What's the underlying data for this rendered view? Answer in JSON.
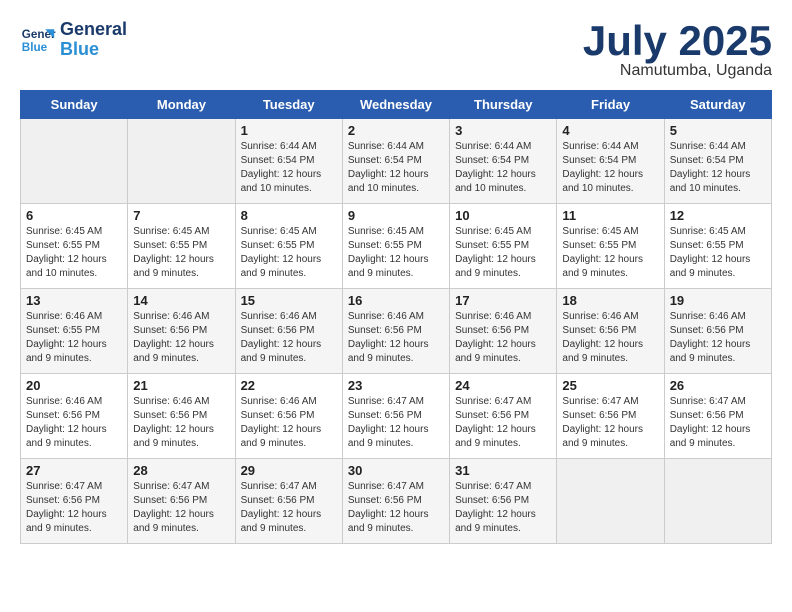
{
  "logo": {
    "line1": "General",
    "line2": "Blue"
  },
  "title": "July 2025",
  "subtitle": "Namutumba, Uganda",
  "days_of_week": [
    "Sunday",
    "Monday",
    "Tuesday",
    "Wednesday",
    "Thursday",
    "Friday",
    "Saturday"
  ],
  "weeks": [
    [
      {
        "day": "",
        "sunrise": "",
        "sunset": "",
        "daylight": ""
      },
      {
        "day": "",
        "sunrise": "",
        "sunset": "",
        "daylight": ""
      },
      {
        "day": "1",
        "sunrise": "Sunrise: 6:44 AM",
        "sunset": "Sunset: 6:54 PM",
        "daylight": "Daylight: 12 hours and 10 minutes."
      },
      {
        "day": "2",
        "sunrise": "Sunrise: 6:44 AM",
        "sunset": "Sunset: 6:54 PM",
        "daylight": "Daylight: 12 hours and 10 minutes."
      },
      {
        "day": "3",
        "sunrise": "Sunrise: 6:44 AM",
        "sunset": "Sunset: 6:54 PM",
        "daylight": "Daylight: 12 hours and 10 minutes."
      },
      {
        "day": "4",
        "sunrise": "Sunrise: 6:44 AM",
        "sunset": "Sunset: 6:54 PM",
        "daylight": "Daylight: 12 hours and 10 minutes."
      },
      {
        "day": "5",
        "sunrise": "Sunrise: 6:44 AM",
        "sunset": "Sunset: 6:54 PM",
        "daylight": "Daylight: 12 hours and 10 minutes."
      }
    ],
    [
      {
        "day": "6",
        "sunrise": "Sunrise: 6:45 AM",
        "sunset": "Sunset: 6:55 PM",
        "daylight": "Daylight: 12 hours and 10 minutes."
      },
      {
        "day": "7",
        "sunrise": "Sunrise: 6:45 AM",
        "sunset": "Sunset: 6:55 PM",
        "daylight": "Daylight: 12 hours and 9 minutes."
      },
      {
        "day": "8",
        "sunrise": "Sunrise: 6:45 AM",
        "sunset": "Sunset: 6:55 PM",
        "daylight": "Daylight: 12 hours and 9 minutes."
      },
      {
        "day": "9",
        "sunrise": "Sunrise: 6:45 AM",
        "sunset": "Sunset: 6:55 PM",
        "daylight": "Daylight: 12 hours and 9 minutes."
      },
      {
        "day": "10",
        "sunrise": "Sunrise: 6:45 AM",
        "sunset": "Sunset: 6:55 PM",
        "daylight": "Daylight: 12 hours and 9 minutes."
      },
      {
        "day": "11",
        "sunrise": "Sunrise: 6:45 AM",
        "sunset": "Sunset: 6:55 PM",
        "daylight": "Daylight: 12 hours and 9 minutes."
      },
      {
        "day": "12",
        "sunrise": "Sunrise: 6:45 AM",
        "sunset": "Sunset: 6:55 PM",
        "daylight": "Daylight: 12 hours and 9 minutes."
      }
    ],
    [
      {
        "day": "13",
        "sunrise": "Sunrise: 6:46 AM",
        "sunset": "Sunset: 6:55 PM",
        "daylight": "Daylight: 12 hours and 9 minutes."
      },
      {
        "day": "14",
        "sunrise": "Sunrise: 6:46 AM",
        "sunset": "Sunset: 6:56 PM",
        "daylight": "Daylight: 12 hours and 9 minutes."
      },
      {
        "day": "15",
        "sunrise": "Sunrise: 6:46 AM",
        "sunset": "Sunset: 6:56 PM",
        "daylight": "Daylight: 12 hours and 9 minutes."
      },
      {
        "day": "16",
        "sunrise": "Sunrise: 6:46 AM",
        "sunset": "Sunset: 6:56 PM",
        "daylight": "Daylight: 12 hours and 9 minutes."
      },
      {
        "day": "17",
        "sunrise": "Sunrise: 6:46 AM",
        "sunset": "Sunset: 6:56 PM",
        "daylight": "Daylight: 12 hours and 9 minutes."
      },
      {
        "day": "18",
        "sunrise": "Sunrise: 6:46 AM",
        "sunset": "Sunset: 6:56 PM",
        "daylight": "Daylight: 12 hours and 9 minutes."
      },
      {
        "day": "19",
        "sunrise": "Sunrise: 6:46 AM",
        "sunset": "Sunset: 6:56 PM",
        "daylight": "Daylight: 12 hours and 9 minutes."
      }
    ],
    [
      {
        "day": "20",
        "sunrise": "Sunrise: 6:46 AM",
        "sunset": "Sunset: 6:56 PM",
        "daylight": "Daylight: 12 hours and 9 minutes."
      },
      {
        "day": "21",
        "sunrise": "Sunrise: 6:46 AM",
        "sunset": "Sunset: 6:56 PM",
        "daylight": "Daylight: 12 hours and 9 minutes."
      },
      {
        "day": "22",
        "sunrise": "Sunrise: 6:46 AM",
        "sunset": "Sunset: 6:56 PM",
        "daylight": "Daylight: 12 hours and 9 minutes."
      },
      {
        "day": "23",
        "sunrise": "Sunrise: 6:47 AM",
        "sunset": "Sunset: 6:56 PM",
        "daylight": "Daylight: 12 hours and 9 minutes."
      },
      {
        "day": "24",
        "sunrise": "Sunrise: 6:47 AM",
        "sunset": "Sunset: 6:56 PM",
        "daylight": "Daylight: 12 hours and 9 minutes."
      },
      {
        "day": "25",
        "sunrise": "Sunrise: 6:47 AM",
        "sunset": "Sunset: 6:56 PM",
        "daylight": "Daylight: 12 hours and 9 minutes."
      },
      {
        "day": "26",
        "sunrise": "Sunrise: 6:47 AM",
        "sunset": "Sunset: 6:56 PM",
        "daylight": "Daylight: 12 hours and 9 minutes."
      }
    ],
    [
      {
        "day": "27",
        "sunrise": "Sunrise: 6:47 AM",
        "sunset": "Sunset: 6:56 PM",
        "daylight": "Daylight: 12 hours and 9 minutes."
      },
      {
        "day": "28",
        "sunrise": "Sunrise: 6:47 AM",
        "sunset": "Sunset: 6:56 PM",
        "daylight": "Daylight: 12 hours and 9 minutes."
      },
      {
        "day": "29",
        "sunrise": "Sunrise: 6:47 AM",
        "sunset": "Sunset: 6:56 PM",
        "daylight": "Daylight: 12 hours and 9 minutes."
      },
      {
        "day": "30",
        "sunrise": "Sunrise: 6:47 AM",
        "sunset": "Sunset: 6:56 PM",
        "daylight": "Daylight: 12 hours and 9 minutes."
      },
      {
        "day": "31",
        "sunrise": "Sunrise: 6:47 AM",
        "sunset": "Sunset: 6:56 PM",
        "daylight": "Daylight: 12 hours and 9 minutes."
      },
      {
        "day": "",
        "sunrise": "",
        "sunset": "",
        "daylight": ""
      },
      {
        "day": "",
        "sunrise": "",
        "sunset": "",
        "daylight": ""
      }
    ]
  ]
}
